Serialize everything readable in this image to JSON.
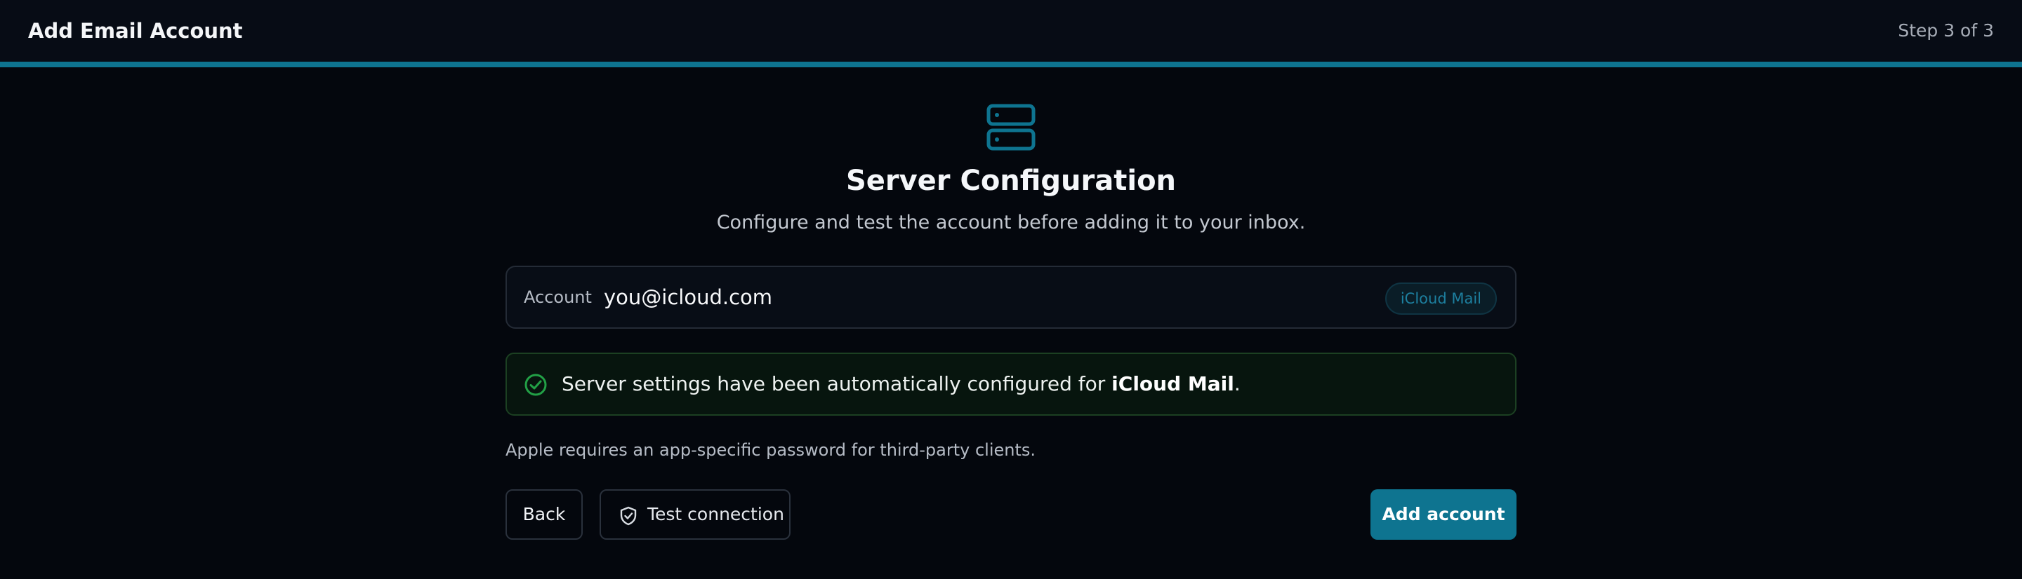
{
  "header": {
    "title": "Add Email Account",
    "step": "Step 3 of 3"
  },
  "colors": {
    "accent": "#0e7490",
    "background": "#04070d",
    "success": "#22a046"
  },
  "main": {
    "icon": "server-icon",
    "title": "Server Configuration",
    "subtitle": "Configure and test the account before adding it to your inbox."
  },
  "account": {
    "label": "Account",
    "email": "you@icloud.com",
    "provider_badge": "iCloud Mail"
  },
  "status": {
    "icon": "check-circle-icon",
    "message_prefix": "Server settings have been automatically configured for ",
    "provider": "iCloud Mail",
    "message_suffix": "."
  },
  "note": "Apple requires an app-specific password for third-party clients.",
  "actions": {
    "back_label": "Back",
    "test_label": "Test connection",
    "test_icon": "shield-check-icon",
    "add_label": "Add account"
  }
}
